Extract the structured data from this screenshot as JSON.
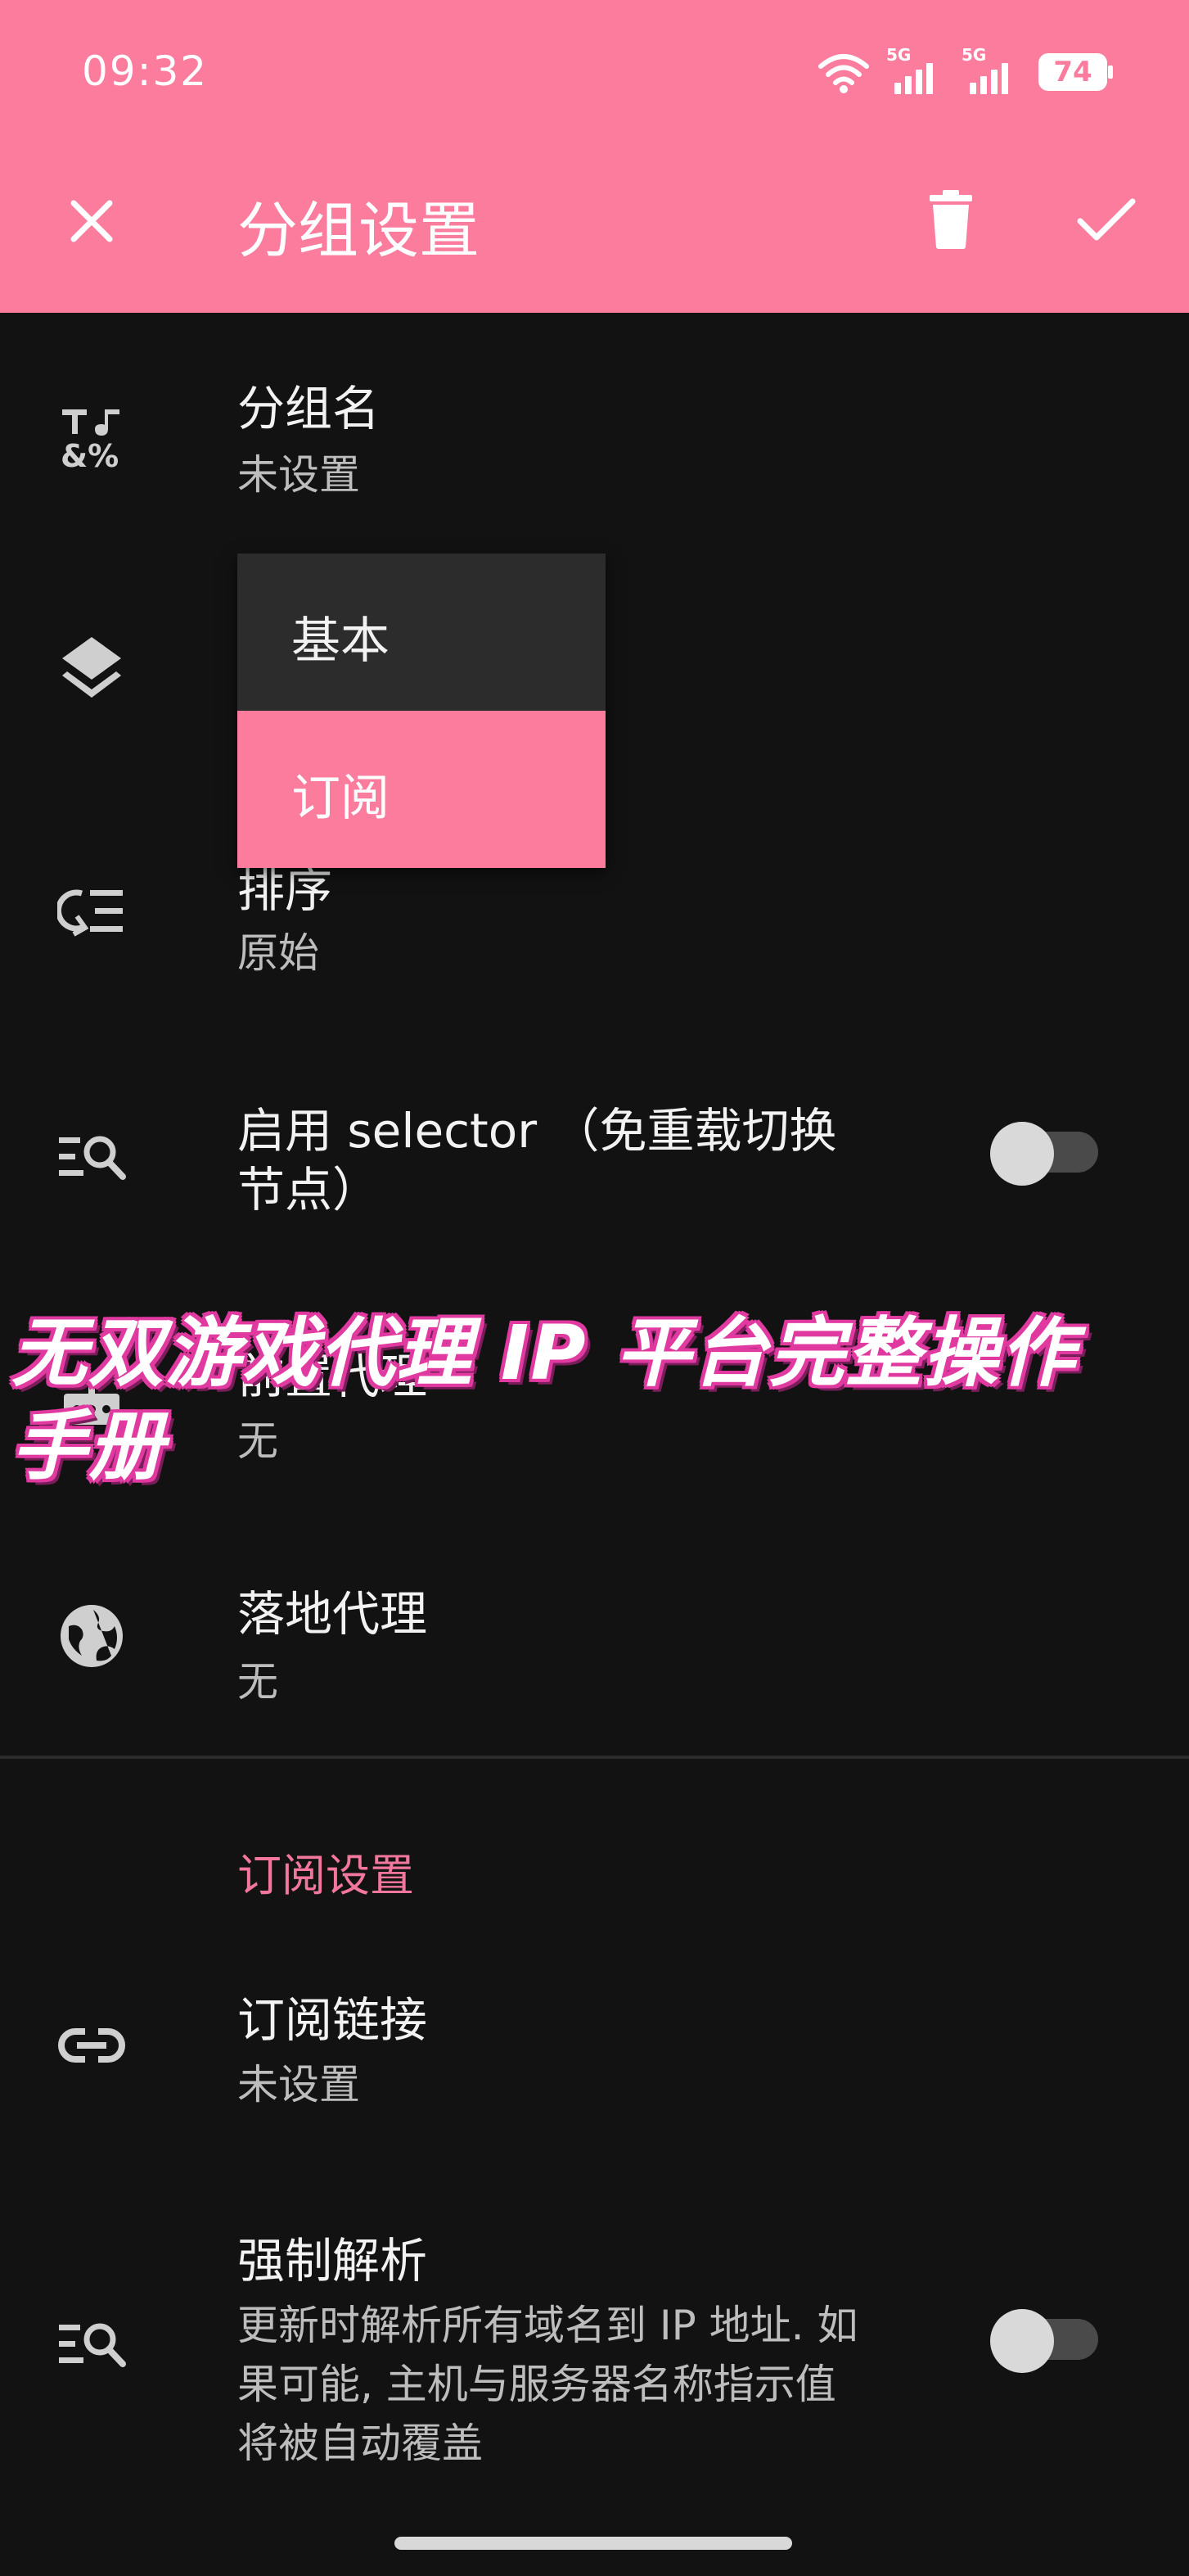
{
  "status": {
    "time": "09:32",
    "signal1_label": "5G",
    "signal2_label": "5G",
    "battery": "74"
  },
  "appbar": {
    "title": "分组设置"
  },
  "rows": {
    "group_name": {
      "title": "分组名",
      "value": "未设置",
      "icon": "text-format-icon"
    },
    "type": {
      "icon": "layers-icon"
    },
    "sort": {
      "title": "排序",
      "value": "原始",
      "icon": "sort-list-icon"
    },
    "selector": {
      "title_line1": "启用 selector （免重载切换",
      "title_line2": "节点）",
      "icon": "list-search-icon",
      "enabled": false
    },
    "front_proxy": {
      "title": "前置代理",
      "value": "无",
      "icon": "router-icon"
    },
    "landing_proxy": {
      "title": "落地代理",
      "value": "无",
      "icon": "globe-icon"
    }
  },
  "dropdown": {
    "options": [
      "基本",
      "订阅"
    ],
    "selected": "订阅"
  },
  "subscription_section": {
    "header": "订阅设置",
    "link": {
      "title": "订阅链接",
      "value": "未设置",
      "icon": "link-icon"
    },
    "force_resolve": {
      "title": "强制解析",
      "desc_line1": "更新时解析所有域名到 IP 地址. 如",
      "desc_line2": "果可能, 主机与服务器名称指示值",
      "desc_line3": "将被自动覆盖",
      "icon": "list-search-icon",
      "enabled": false
    }
  },
  "watermark": {
    "line1": "无双游戏代理 IP 平台完整操作",
    "line2": "手册"
  },
  "colors": {
    "accent": "#fb7c9d",
    "background": "#121212",
    "section_header": "#f3769c"
  }
}
